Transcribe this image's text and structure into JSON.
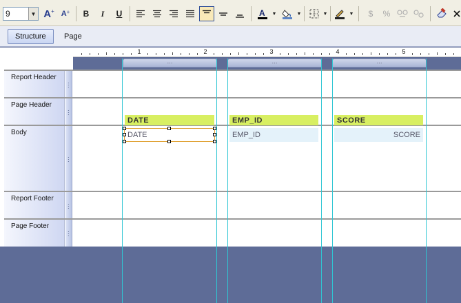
{
  "toolbar": {
    "font_size": "9",
    "dropdown_arrow": "▼",
    "bold_label": "B",
    "italic_label": "I",
    "underline_label": "U",
    "grow_font_glyph": "A",
    "shrink_font_glyph": "A",
    "currency_glyph": "$",
    "percent_glyph": "%"
  },
  "tabs": [
    {
      "label": "Structure",
      "active": true
    },
    {
      "label": "Page",
      "active": false
    }
  ],
  "ruler": {
    "numbers": [
      "1",
      "2",
      "3",
      "4",
      "5"
    ]
  },
  "bands": [
    {
      "label": "Report Header"
    },
    {
      "label": "Page Header"
    },
    {
      "label": "Body"
    },
    {
      "label": "Report Footer"
    },
    {
      "label": "Page Footer"
    }
  ],
  "columns": [
    {
      "header": "DATE",
      "field": "DATE",
      "align": "left",
      "selected": true
    },
    {
      "header": "EMP_ID",
      "field": "EMP_ID",
      "align": "left",
      "selected": false
    },
    {
      "header": "SCORE",
      "field": "SCORE",
      "align": "right",
      "selected": false
    }
  ],
  "colors": {
    "header_cell": "#d8ef62",
    "data_cell": "#e4f2fa",
    "guide": "#2fc6d3",
    "selection": "#e0a235",
    "workspace": "#5e6c97"
  }
}
